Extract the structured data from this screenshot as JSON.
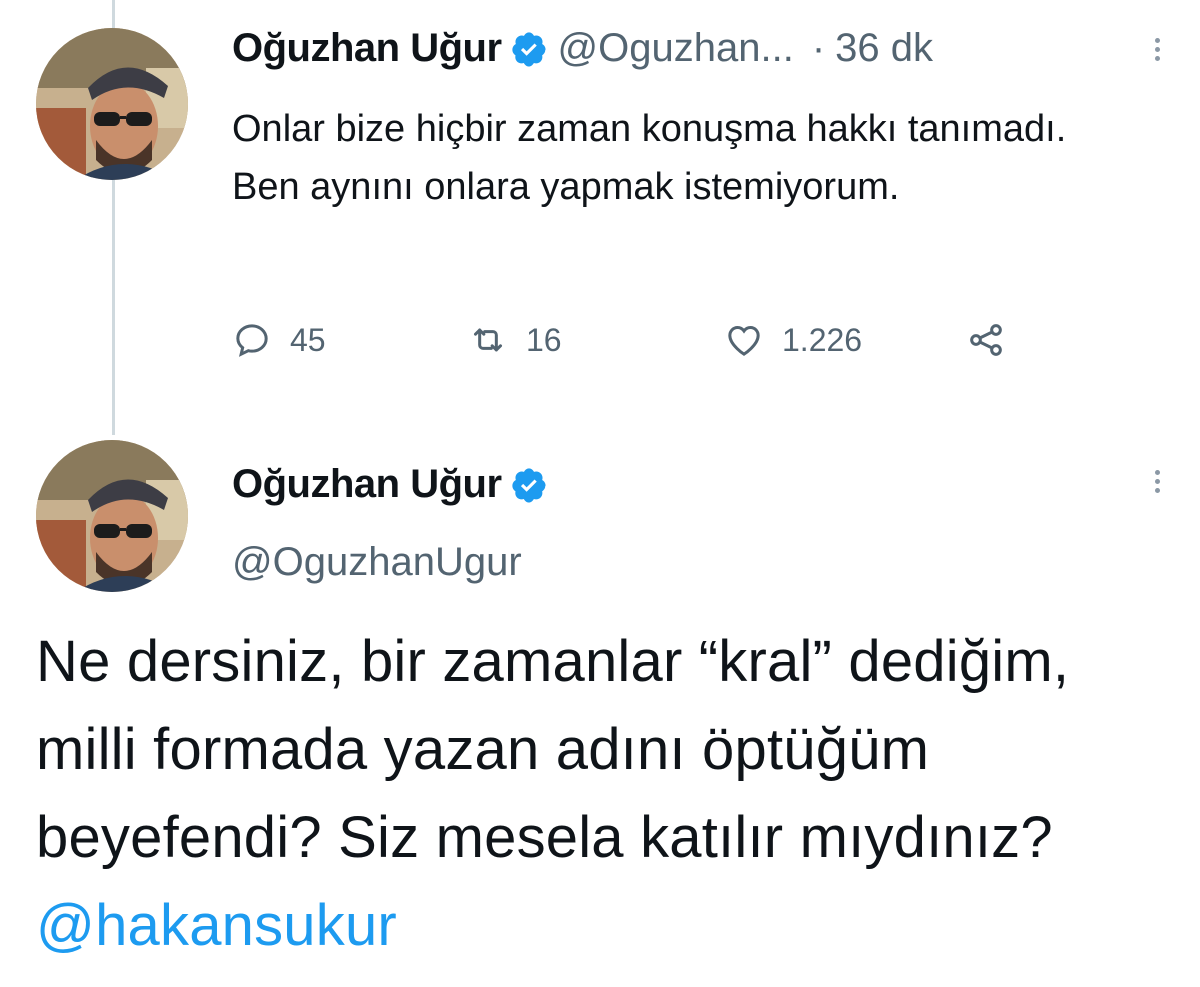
{
  "tweet1": {
    "name": "Oğuzhan Uğur",
    "handle": "@Oguzhan...",
    "separator": "·",
    "time": "36 dk",
    "text": "Onlar bize hiçbir zaman konuşma hakkı tanımadı. Ben aynını onlara yapmak istemiyorum.",
    "actions": {
      "replies": "45",
      "retweets": "16",
      "likes": "1.226"
    }
  },
  "tweet2": {
    "name": "Oğuzhan Uğur",
    "handle": "@OguzhanUgur",
    "text": "Ne dersiniz, bir zamanlar “kral” dediğim, milli formada yazan adını öptüğüm beyefendi? Siz mesela katılır mıydınız?",
    "mention": "@hakansukur"
  },
  "icons": {
    "verified": "verified-badge-icon",
    "reply": "reply-icon",
    "retweet": "retweet-icon",
    "like": "heart-icon",
    "share": "share-icon",
    "more": "more-options-icon"
  },
  "colors": {
    "verified_blue": "#1d9bf0",
    "mention_blue": "#1d9bf0",
    "secondary_text": "#536471"
  }
}
